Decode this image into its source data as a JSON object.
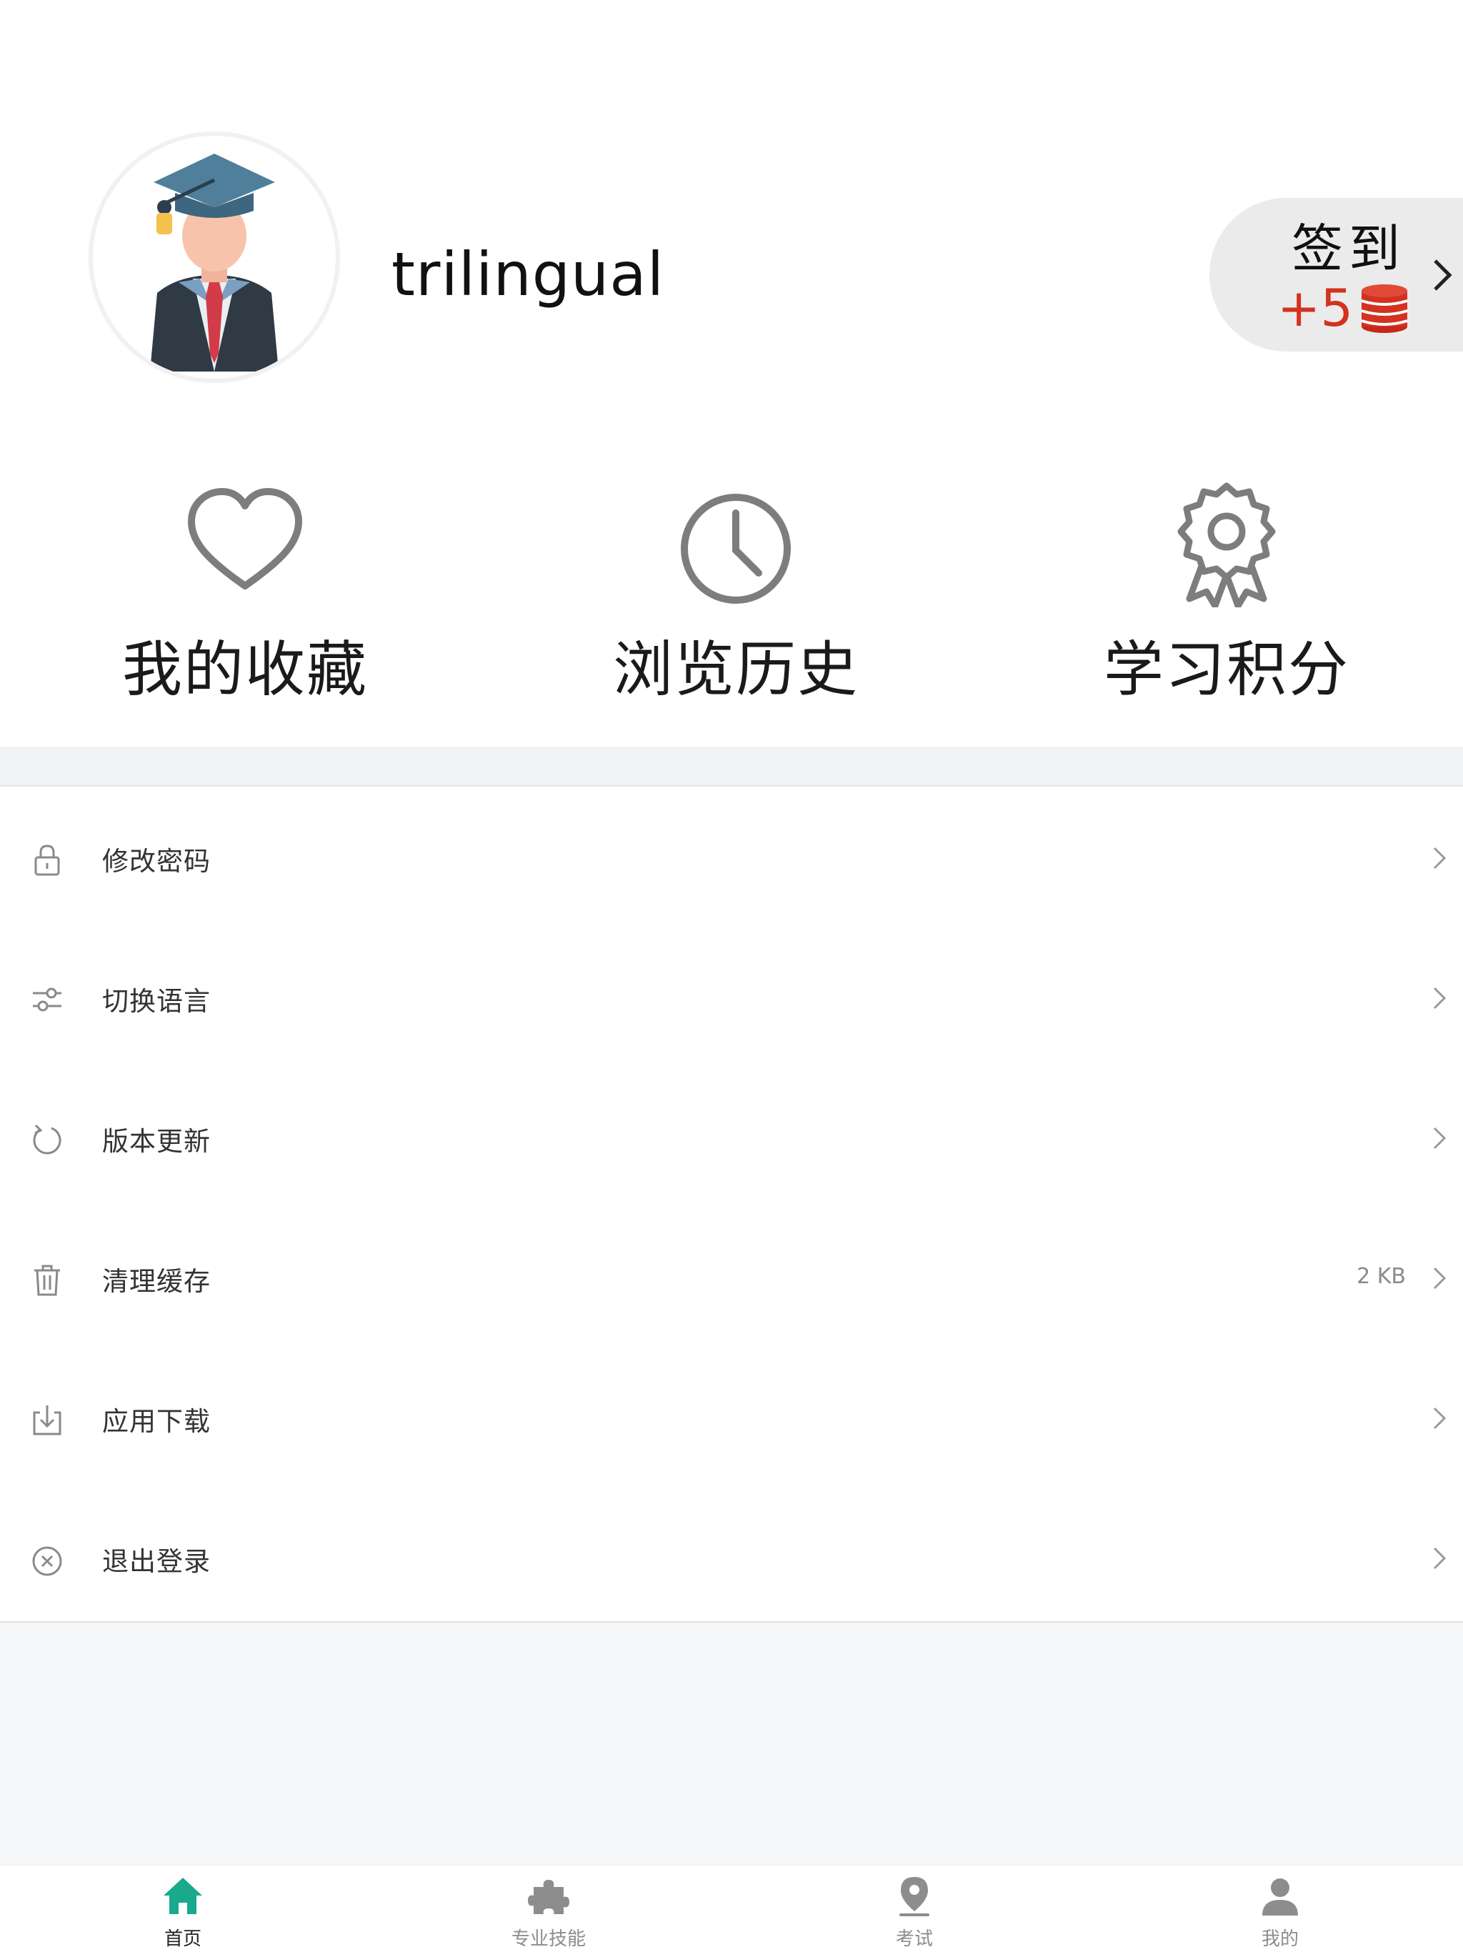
{
  "profile": {
    "username": "trilingual"
  },
  "checkin": {
    "label": "签到",
    "bonus": "+5"
  },
  "quick_actions": [
    {
      "label": "我的收藏",
      "icon": "heart-icon"
    },
    {
      "label": "浏览历史",
      "icon": "clock-icon"
    },
    {
      "label": "学习积分",
      "icon": "award-icon"
    }
  ],
  "settings": [
    {
      "label": "修改密码",
      "icon": "lock-icon",
      "value": ""
    },
    {
      "label": "切换语言",
      "icon": "sliders-icon",
      "value": ""
    },
    {
      "label": "版本更新",
      "icon": "refresh-icon",
      "value": ""
    },
    {
      "label": "清理缓存",
      "icon": "trash-icon",
      "value": "2 KB"
    },
    {
      "label": "应用下载",
      "icon": "download-icon",
      "value": ""
    },
    {
      "label": "退出登录",
      "icon": "logout-icon",
      "value": ""
    }
  ],
  "tabs": [
    {
      "label": "首页",
      "icon": "home-icon",
      "active": true
    },
    {
      "label": "专业技能",
      "icon": "puzzle-icon",
      "active": false
    },
    {
      "label": "考试",
      "icon": "pin-icon",
      "active": false
    },
    {
      "label": "我的",
      "icon": "person-icon",
      "active": false
    }
  ],
  "colors": {
    "accent": "#19a98c",
    "bonus": "#d2321f",
    "icon_gray": "#7d7d7d"
  }
}
